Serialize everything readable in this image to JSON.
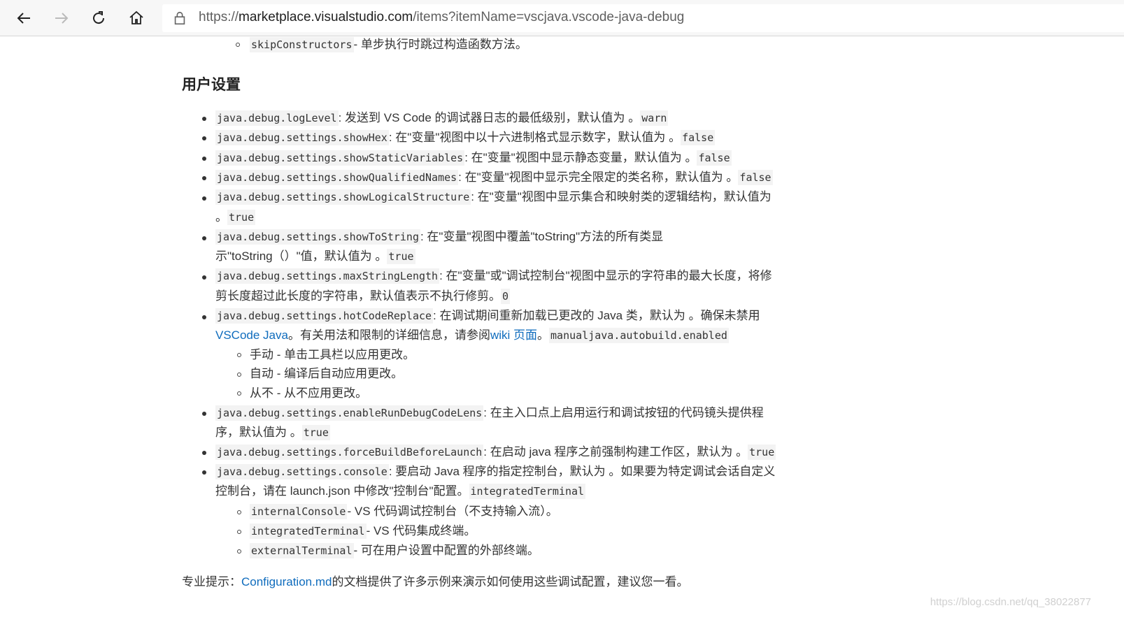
{
  "browser": {
    "url_prefix": "https://",
    "url_host": "marketplace.visualstudio.com",
    "url_path": "/items?itemName=vscjava.vscode-java-debug"
  },
  "top_sub_item": {
    "code": "skipConstructors",
    "text": "- 单步执行时跳过构造函数方法。"
  },
  "heading": "用户设置",
  "items": [
    {
      "code": "java.debug.logLevel",
      "text": ": 发送到 VS Code 的调试器日志的最低级别，默认值为 。",
      "value": "warn"
    },
    {
      "code": "java.debug.settings.showHex",
      "text": ": 在\"变量\"视图中以十六进制格式显示数字，默认值为 。",
      "value": "false"
    },
    {
      "code": "java.debug.settings.showStaticVariables",
      "text": ": 在\"变量\"视图中显示静态变量，默认值为 。",
      "value": "false"
    },
    {
      "code": "java.debug.settings.showQualifiedNames",
      "text": ": 在\"变量\"视图中显示完全限定的类名称，默认值为 。",
      "value": "false"
    },
    {
      "code": "java.debug.settings.showLogicalStructure",
      "text": ": 在\"变量\"视图中显示集合和映射类的逻辑结构，默认值为",
      "text2": "。",
      "value": "true"
    },
    {
      "code": "java.debug.settings.showToString",
      "text": ": 在\"变量\"视图中覆盖\"toString\"方法的所有类显",
      "text2": "示\"toString（）\"值，默认值为 。",
      "value": "true"
    },
    {
      "code": "java.debug.settings.maxStringLength",
      "text": ": 在\"变量\"或\"调试控制台\"视图中显示的字符串的最大长度，将修",
      "text2": "剪长度超过此长度的字符串，默认值表示不执行修剪。",
      "value": "0"
    },
    {
      "code": "java.debug.settings.hotCodeReplace",
      "text": ": 在调试期间重新加载已更改的 Java 类，默认为 。确保未禁用",
      "link1": "VSCode Java",
      "mid": "。有关用法和限制的详细信息，请参阅",
      "link2": "wiki 页面",
      "after": "。",
      "value": "manualjava.autobuild.enabled",
      "sub": [
        "手动 - 单击工具栏以应用更改。",
        "自动 - 编译后自动应用更改。",
        "从不 - 从不应用更改。"
      ]
    },
    {
      "code": "java.debug.settings.enableRunDebugCodeLens",
      "text": ": 在主入口点上启用运行和调试按钮的代码镜头提供程",
      "text2": "序，默认值为 。",
      "value": "true"
    },
    {
      "code": "java.debug.settings.forceBuildBeforeLaunch",
      "text": ": 在启动 java 程序之前强制构建工作区，默认为 。",
      "value": "true"
    },
    {
      "code": "java.debug.settings.console",
      "text": ": 要启动 Java 程序的指定控制台，默认为 。如果要为特定调试会话自定义",
      "text2": "控制台，请在 launch.json 中修改\"控制台\"配置。",
      "value": "integratedTerminal",
      "sub": [
        {
          "code": "internalConsole",
          "text": "- VS 代码调试控制台（不支持输入流）。"
        },
        {
          "code": "integratedTerminal",
          "text": "- VS 代码集成终端。"
        },
        {
          "code": "externalTerminal",
          "text": "- 可在用户设置中配置的外部终端。"
        }
      ]
    }
  ],
  "tip": {
    "prefix": "专业提示：",
    "link": "Configuration.md",
    "suffix": "的文档提供了许多示例来演示如何使用这些调试配置，建议您一看。"
  },
  "watermark": "https://blog.csdn.net/qq_38022877"
}
